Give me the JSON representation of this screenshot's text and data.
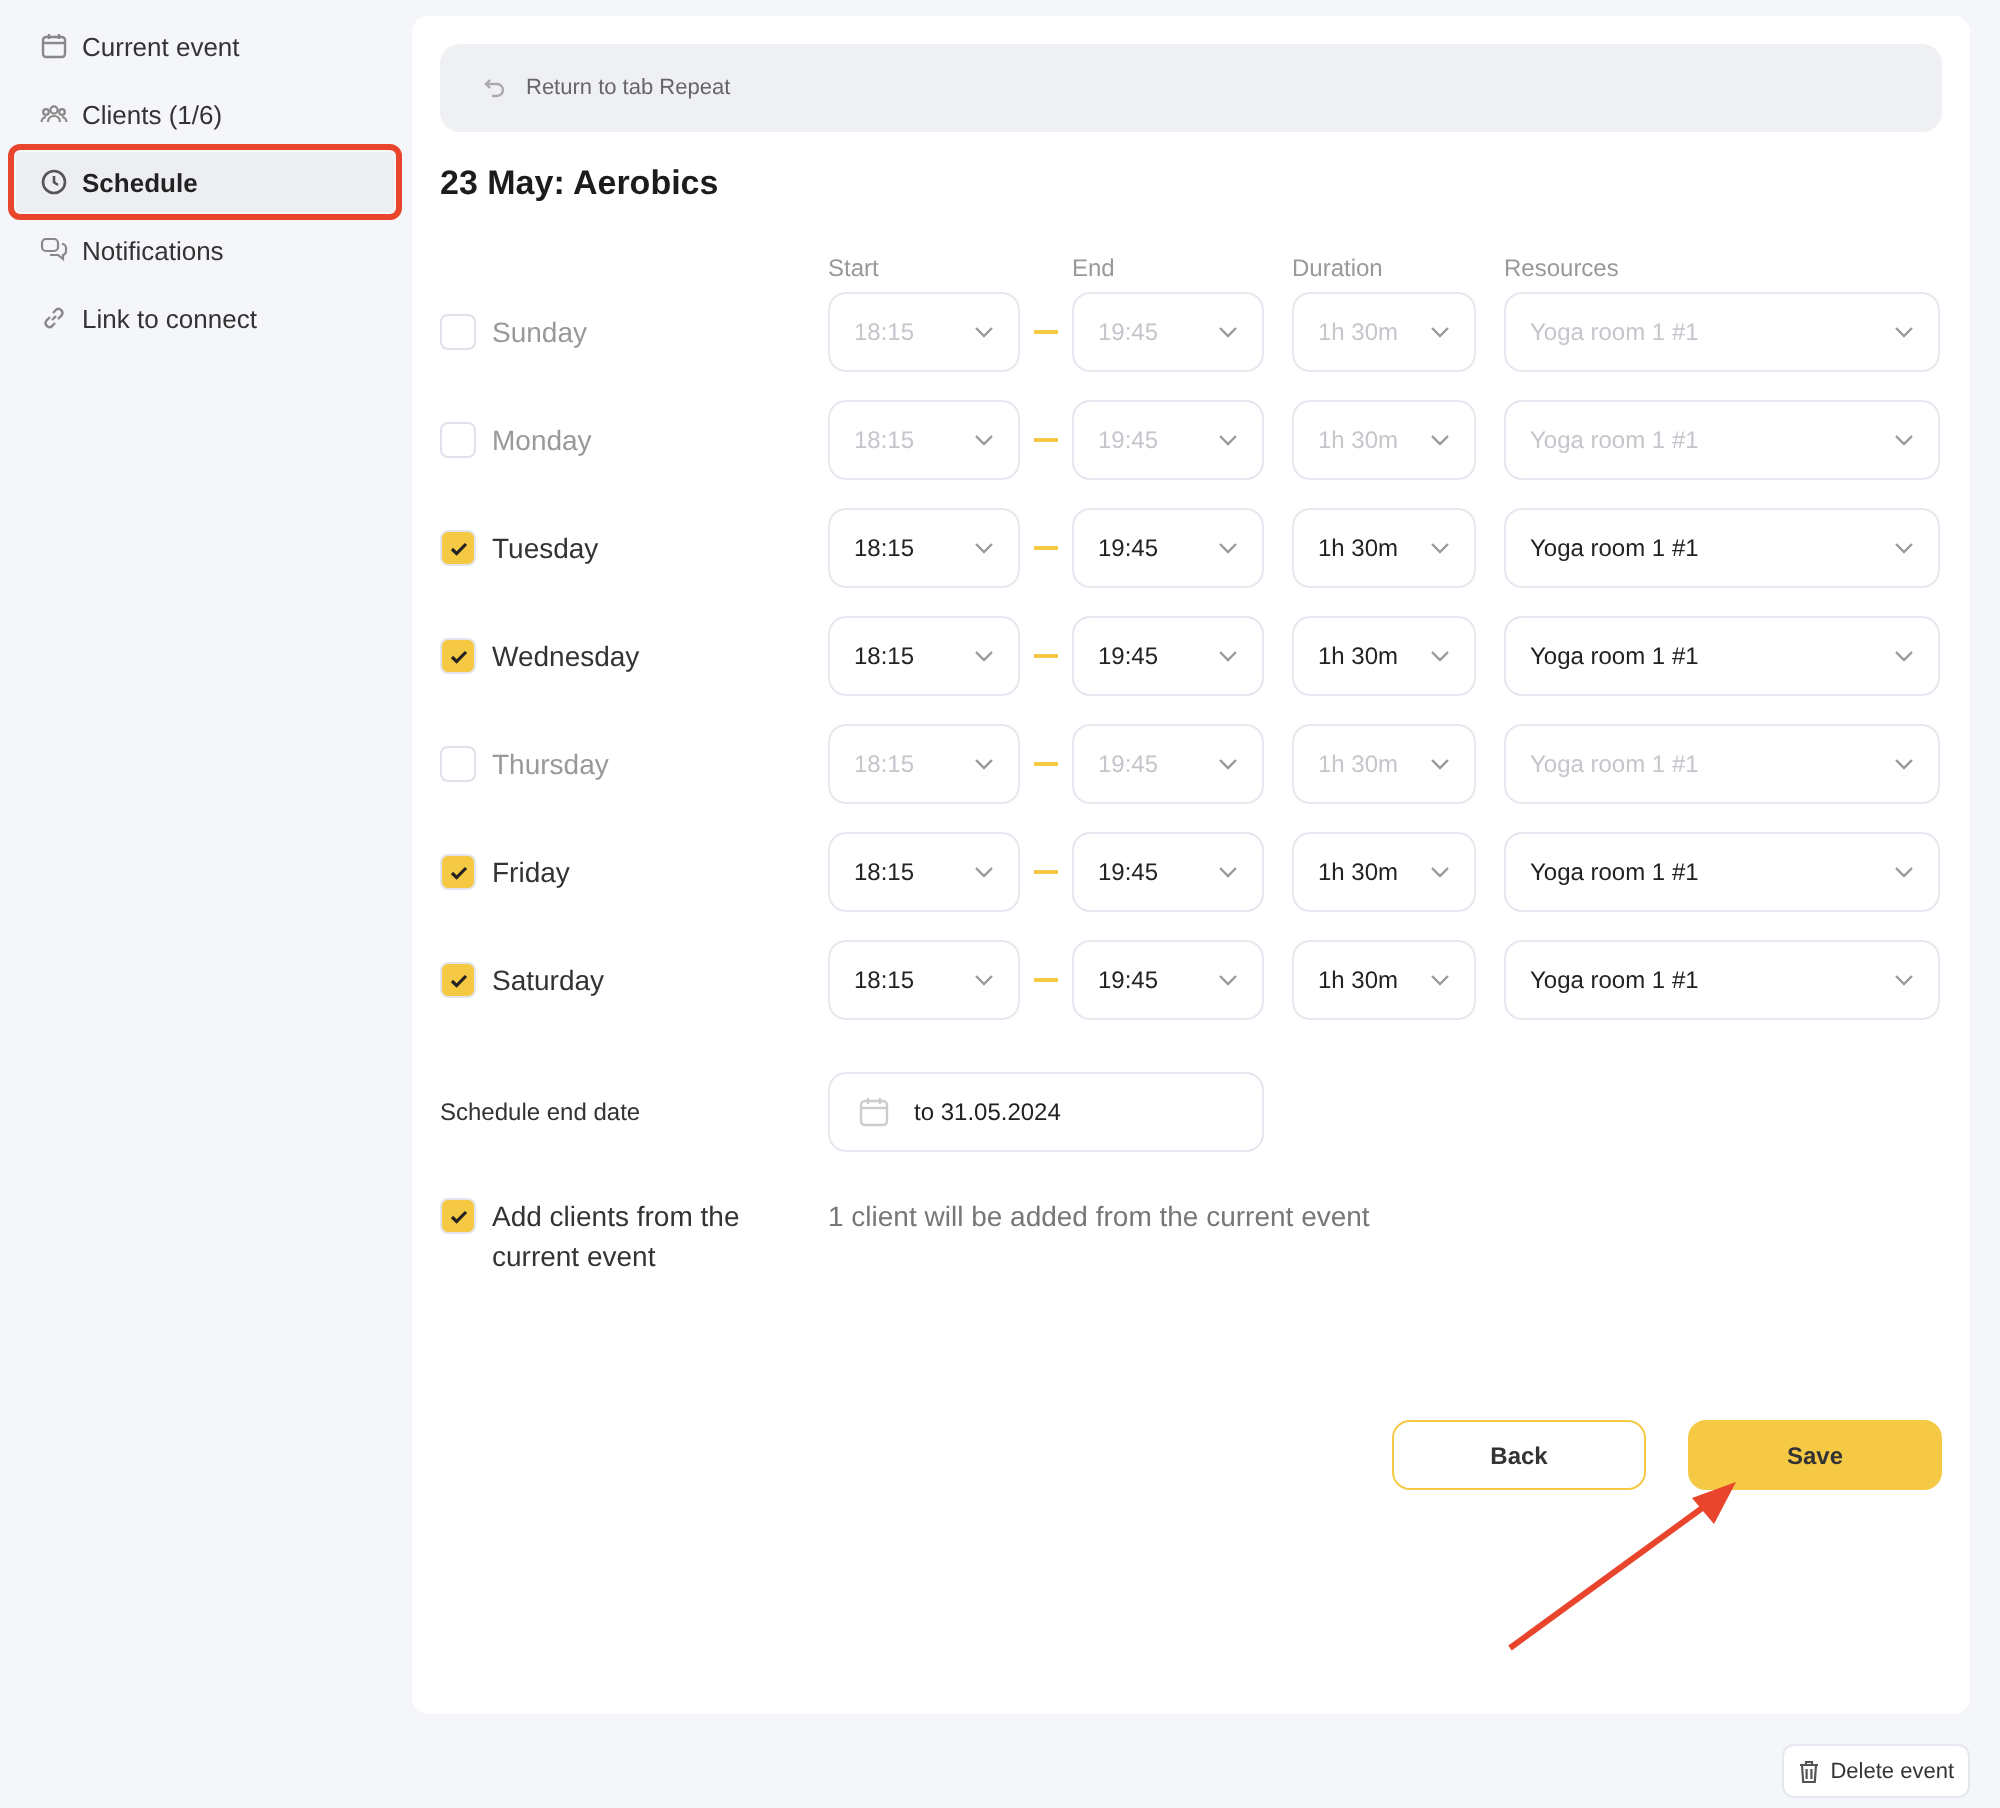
{
  "sidebar": {
    "items": [
      {
        "label": "Current event",
        "selected": false,
        "highlighted": false
      },
      {
        "label": "Clients (1/6)",
        "selected": false,
        "highlighted": false
      },
      {
        "label": "Schedule",
        "selected": true,
        "highlighted": true
      },
      {
        "label": "Notifications",
        "selected": false,
        "highlighted": false
      },
      {
        "label": "Link to connect",
        "selected": false,
        "highlighted": false
      }
    ]
  },
  "return_link": "Return to tab Repeat",
  "title": "23 May: Aerobics",
  "columns": [
    "Start",
    "End",
    "Duration",
    "Resources"
  ],
  "days": [
    {
      "label": "Sunday",
      "checked": false,
      "start": "18:15",
      "end": "19:45",
      "duration": "1h 30m",
      "resource": "Yoga room 1 #1"
    },
    {
      "label": "Monday",
      "checked": false,
      "start": "18:15",
      "end": "19:45",
      "duration": "1h 30m",
      "resource": "Yoga room 1 #1"
    },
    {
      "label": "Tuesday",
      "checked": true,
      "start": "18:15",
      "end": "19:45",
      "duration": "1h 30m",
      "resource": "Yoga room 1 #1"
    },
    {
      "label": "Wednesday",
      "checked": true,
      "start": "18:15",
      "end": "19:45",
      "duration": "1h 30m",
      "resource": "Yoga room 1 #1"
    },
    {
      "label": "Thursday",
      "checked": false,
      "start": "18:15",
      "end": "19:45",
      "duration": "1h 30m",
      "resource": "Yoga room 1 #1"
    },
    {
      "label": "Friday",
      "checked": true,
      "start": "18:15",
      "end": "19:45",
      "duration": "1h 30m",
      "resource": "Yoga room 1 #1"
    },
    {
      "label": "Saturday",
      "checked": true,
      "start": "18:15",
      "end": "19:45",
      "duration": "1h 30m",
      "resource": "Yoga room 1 #1"
    }
  ],
  "end_date": {
    "label": "Schedule end date",
    "value": "to 31.05.2024"
  },
  "add_clients": {
    "label": "Add clients from the current event",
    "checked": true,
    "note": "1 client will be added from the current event"
  },
  "buttons": [
    {
      "label": "Back",
      "kind": "secondary"
    },
    {
      "label": "Save",
      "kind": "primary"
    }
  ],
  "delete_button": "Delete event"
}
